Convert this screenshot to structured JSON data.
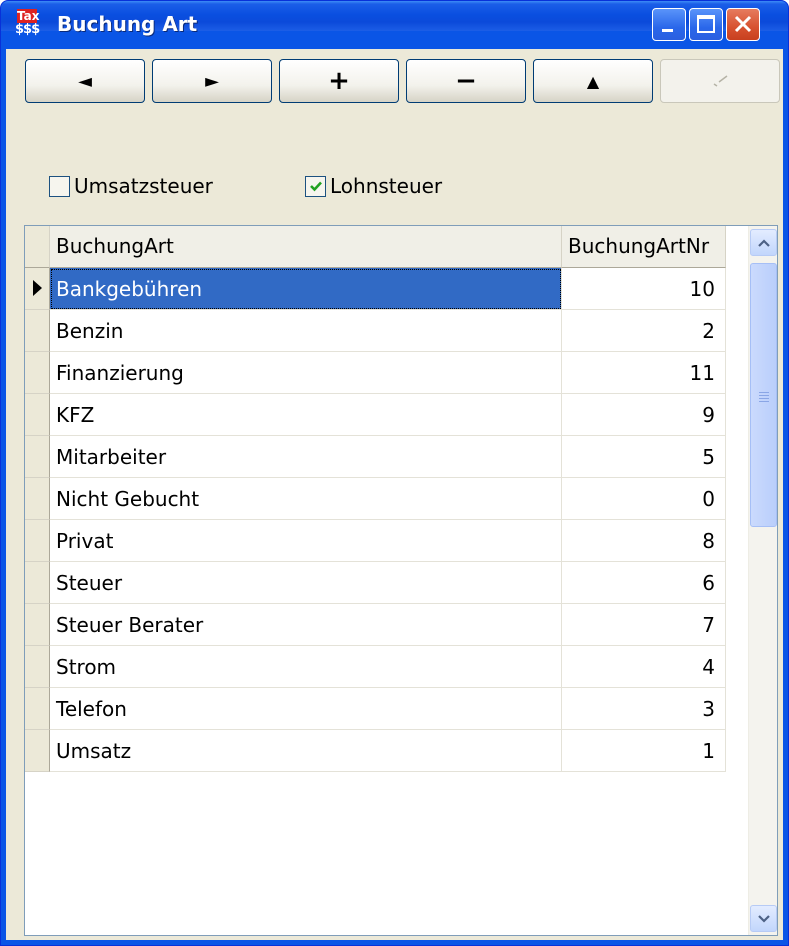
{
  "window": {
    "title": "Buchung Art",
    "icon_text_top": "Tax",
    "icon_text_bottom": "$$$"
  },
  "toolbar": {
    "first_glyph": "◄",
    "next_glyph": "►",
    "add_glyph": "+",
    "remove_glyph": "−",
    "up_glyph": "▲"
  },
  "filters": {
    "umsatzsteuer": {
      "label": "Umsatzsteuer",
      "checked": false
    },
    "lohnsteuer": {
      "label": "Lohnsteuer",
      "checked": true
    }
  },
  "grid": {
    "columns": [
      "BuchungArt",
      "BuchungArtNr"
    ],
    "rows": [
      {
        "name": "Bankgebühren",
        "nr": "10"
      },
      {
        "name": "Benzin",
        "nr": "2"
      },
      {
        "name": "Finanzierung",
        "nr": "11"
      },
      {
        "name": "KFZ",
        "nr": "9"
      },
      {
        "name": "Mitarbeiter",
        "nr": "5"
      },
      {
        "name": "Nicht Gebucht",
        "nr": "0"
      },
      {
        "name": "Privat",
        "nr": "8"
      },
      {
        "name": "Steuer",
        "nr": "6"
      },
      {
        "name": "Steuer Berater",
        "nr": "7"
      },
      {
        "name": "Strom",
        "nr": "4"
      },
      {
        "name": "Telefon",
        "nr": "3"
      },
      {
        "name": "Umsatz",
        "nr": "1"
      }
    ]
  },
  "colors": {
    "selection": "#316ac5",
    "titlebar": "#0a4fe0",
    "client": "#ece9d8"
  }
}
